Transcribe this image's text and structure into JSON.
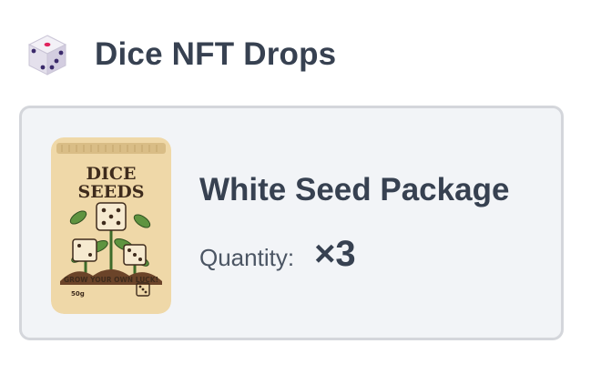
{
  "header": {
    "icon": "dice-icon",
    "title": "Dice NFT Drops"
  },
  "item": {
    "name": "White Seed Package",
    "quantity_label": "Quantity:",
    "quantity_value": "×3",
    "image": {
      "icon": "seed-package-image",
      "package_title_line1": "DICE",
      "package_title_line2": "SEEDS",
      "slogan": "GROW YOUR OWN LUCK!",
      "weight": "50g"
    }
  },
  "colors": {
    "text_dark": "#374151",
    "card_bg": "#f2f4f7",
    "card_border": "#d4d6db",
    "package_bg": "#efd8a8"
  }
}
